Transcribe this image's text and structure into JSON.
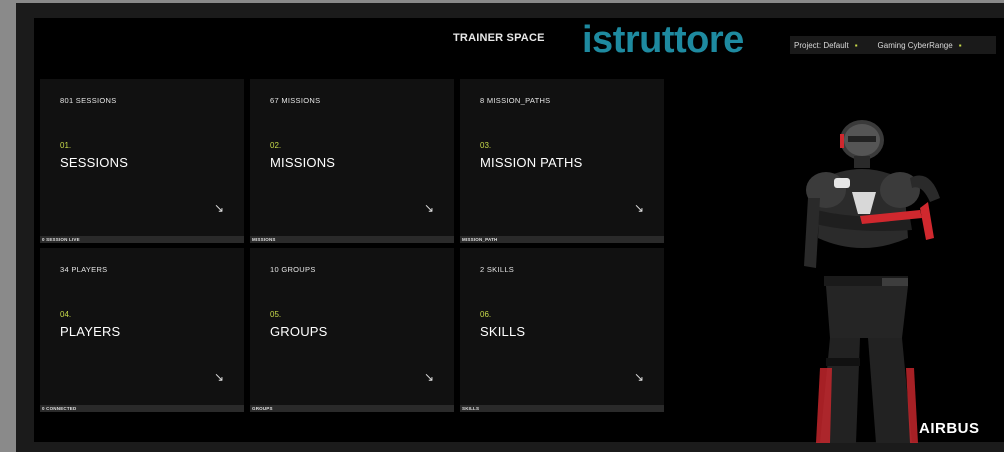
{
  "header": {
    "title": "TRAINER SPACE",
    "brand": "istruttore",
    "project": "Project: Default",
    "range": "Gaming CyberRange"
  },
  "cards": [
    {
      "count": "801 SESSIONS",
      "num": "01.",
      "name": "SESSIONS",
      "footer": "0 SESSION LIVE"
    },
    {
      "count": "67 MISSIONS",
      "num": "02.",
      "name": "MISSIONS",
      "footer": "MISSIONS"
    },
    {
      "count": "8 MISSION_PATHS",
      "num": "03.",
      "name": "MISSION PATHS",
      "footer": "MISSION_PATH"
    },
    {
      "count": "34 PLAYERS",
      "num": "04.",
      "name": "PLAYERS",
      "footer": "0 CONNECTED"
    },
    {
      "count": "10 GROUPS",
      "num": "05.",
      "name": "GROUPS",
      "footer": "GROUPS"
    },
    {
      "count": "2 SKILLS",
      "num": "06.",
      "name": "SKILLS",
      "footer": "SKILLS"
    }
  ],
  "arrow_glyph": "↘",
  "logo": "AIRBUS",
  "colors": {
    "accent": "#c9dc4a",
    "brand": "#1e8aa0",
    "suit_red": "#d0282e"
  }
}
